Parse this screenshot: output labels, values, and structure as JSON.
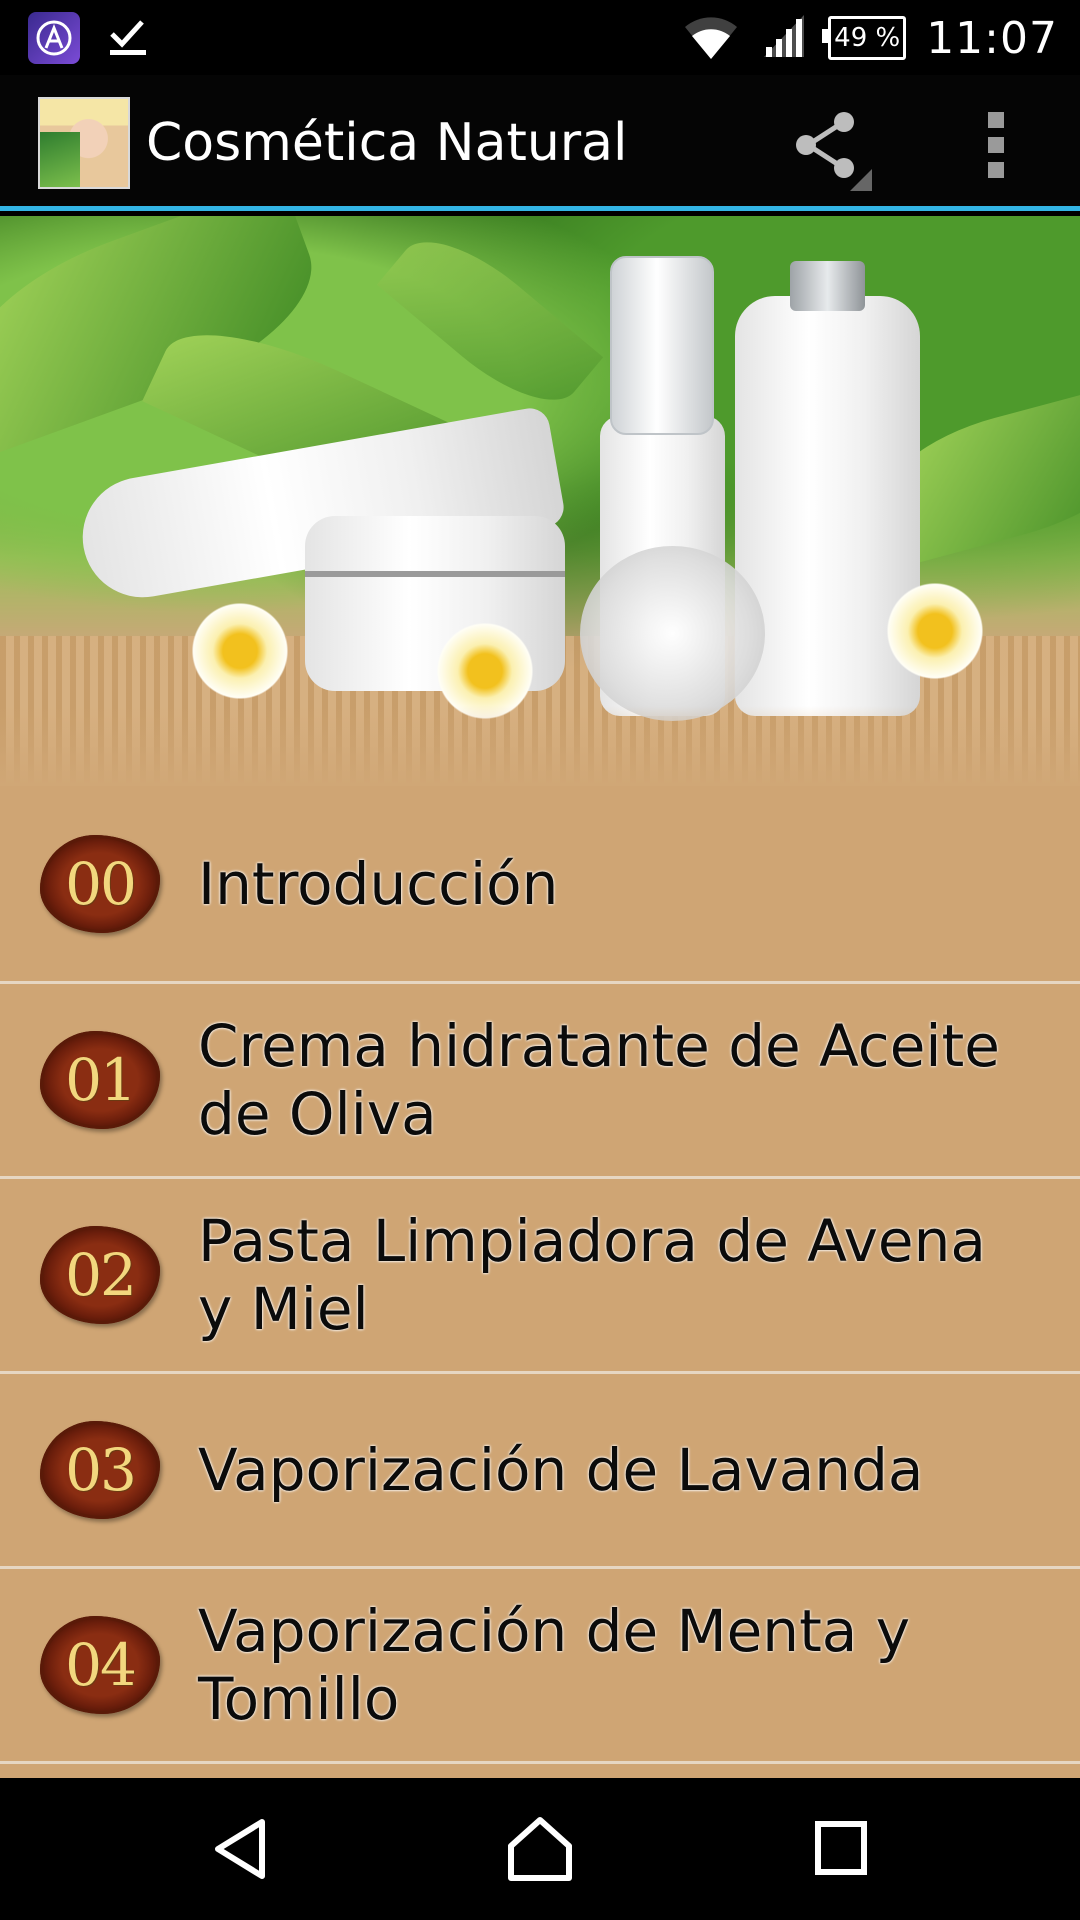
{
  "status_bar": {
    "battery": "49 %",
    "time": "11:07"
  },
  "app_bar": {
    "title": "Cosmética Natural"
  },
  "accent_color": "#33b5e5",
  "list_background": "#cfa574",
  "items": [
    {
      "number": "00",
      "label": "Introducción"
    },
    {
      "number": "01",
      "label": "Crema hidratante de Aceite de Oliva"
    },
    {
      "number": "02",
      "label": "Pasta Limpiadora de Avena y Miel"
    },
    {
      "number": "03",
      "label": "Vaporización de Lavanda"
    },
    {
      "number": "04",
      "label": "Vaporización de Menta y Tomillo"
    }
  ],
  "icons": {
    "status_left": [
      "app-notification-icon",
      "check-download-icon"
    ],
    "status_right": [
      "wifi-icon",
      "signal-icon",
      "battery-icon"
    ],
    "app_bar": [
      "share-icon",
      "overflow-menu-icon"
    ],
    "nav": [
      "back-icon",
      "home-icon",
      "recents-icon"
    ]
  }
}
